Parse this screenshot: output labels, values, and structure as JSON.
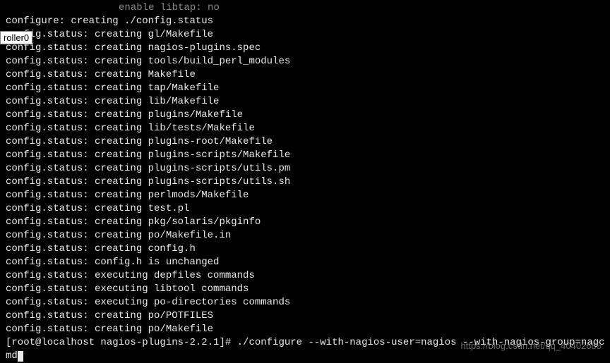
{
  "partial_top": "enable libtap: no",
  "lines": [
    "configure: creating ./config.status",
    "config.status: creating gl/Makefile",
    "config.status: creating nagios-plugins.spec",
    "config.status: creating tools/build_perl_modules",
    "config.status: creating Makefile",
    "config.status: creating tap/Makefile",
    "config.status: creating lib/Makefile",
    "config.status: creating plugins/Makefile",
    "config.status: creating lib/tests/Makefile",
    "config.status: creating plugins-root/Makefile",
    "config.status: creating plugins-scripts/Makefile",
    "config.status: creating plugins-scripts/utils.pm",
    "config.status: creating plugins-scripts/utils.sh",
    "config.status: creating perlmods/Makefile",
    "config.status: creating test.pl",
    "config.status: creating pkg/solaris/pkginfo",
    "config.status: creating po/Makefile.in",
    "config.status: creating config.h",
    "config.status: config.h is unchanged",
    "config.status: executing depfiles commands",
    "config.status: executing libtool commands",
    "config.status: executing po-directories commands",
    "config.status: creating po/POTFILES",
    "config.status: creating po/Makefile"
  ],
  "prompt": "[root@localhost nagios-plugins-2.2.1]# ",
  "command": "./configure --with-nagios-user=nagios --with-nagios-group=nagcmd",
  "tooltip": "roller0",
  "watermark": "https://blog.csdn.net/qq_40402685"
}
